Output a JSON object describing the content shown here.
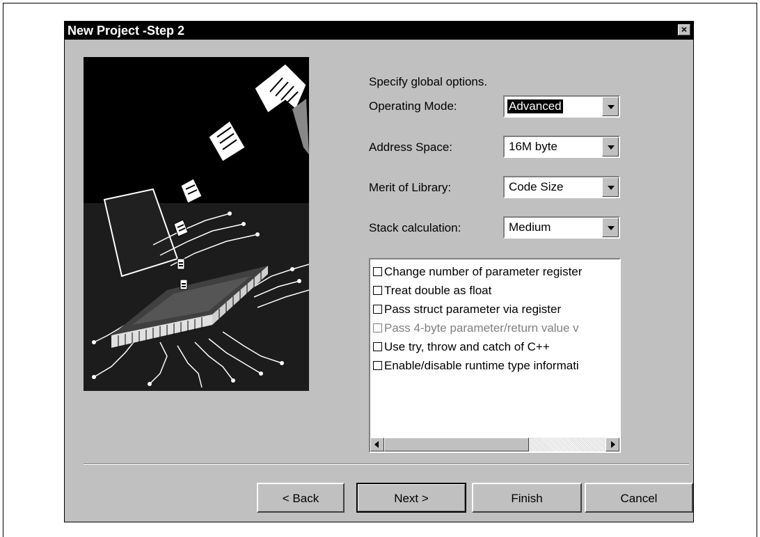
{
  "dialog": {
    "title": "New Project -Step 2",
    "close_symbol": "×",
    "heading": "Specify global options."
  },
  "fields": {
    "operating_mode": {
      "label": "Operating Mode:",
      "value": "Advanced"
    },
    "address_space": {
      "label": "Address Space:",
      "value": "16M byte"
    },
    "merit_of_library": {
      "label": "Merit of Library:",
      "value": "Code Size"
    },
    "stack_calculation": {
      "label": "Stack calculation:",
      "value": "Medium"
    }
  },
  "options": [
    {
      "label": "Change number of parameter register",
      "checked": false,
      "enabled": true
    },
    {
      "label": "Treat double as float",
      "checked": false,
      "enabled": true
    },
    {
      "label": "Pass struct parameter via register",
      "checked": false,
      "enabled": true
    },
    {
      "label": "Pass 4-byte parameter/return value v",
      "checked": false,
      "enabled": false
    },
    {
      "label": "Use try, throw and catch of C++",
      "checked": false,
      "enabled": true
    },
    {
      "label": "Enable/disable runtime type informati",
      "checked": false,
      "enabled": true
    }
  ],
  "buttons": {
    "back": "< Back",
    "next": "Next >",
    "finish": "Finish",
    "cancel": "Cancel"
  },
  "icons": {
    "illustration": "chip-with-documents-illustration",
    "close": "close-icon",
    "dropdown": "dropdown-arrow-icon"
  },
  "colors": {
    "dialog_bg": "#c0c0c0",
    "titlebar_bg": "#000000",
    "disabled_text": "#808080"
  }
}
